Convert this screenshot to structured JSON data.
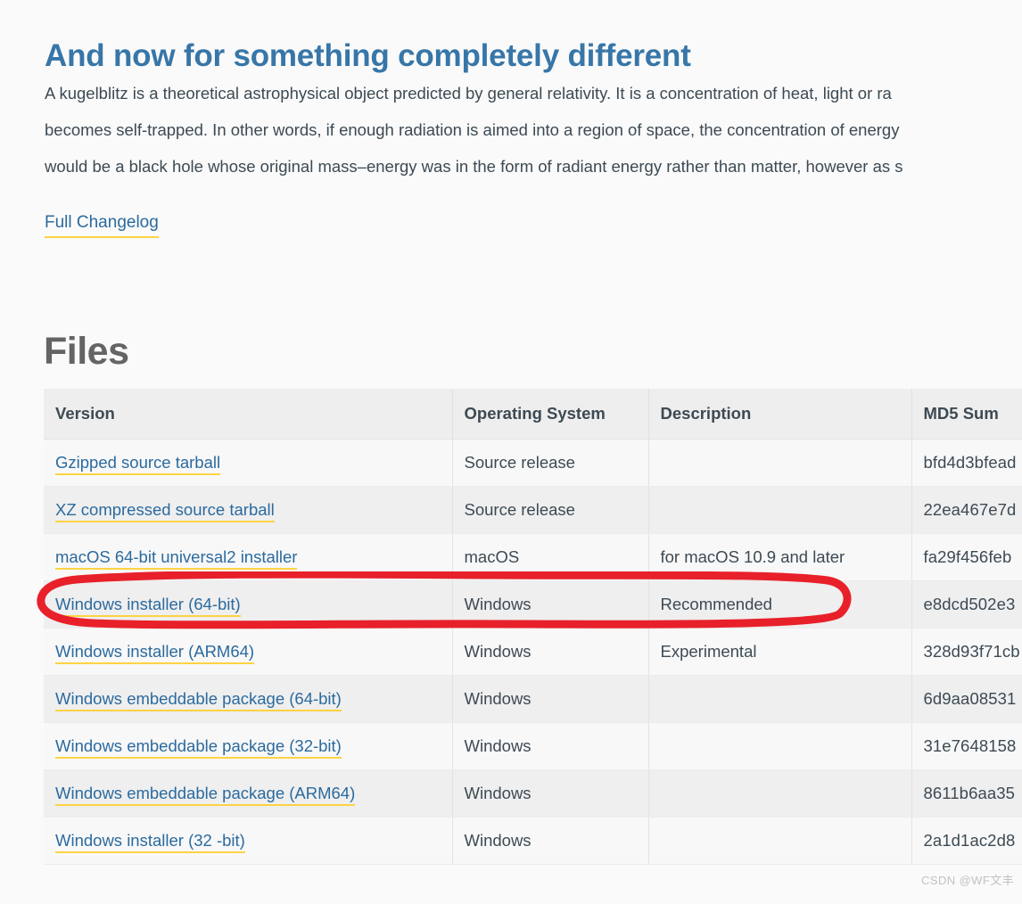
{
  "release": {
    "heading": "And now for something completely different",
    "body_lines": [
      "A kugelblitz is a theoretical astrophysical object predicted by general relativity. It is a concentration of heat, light or ra",
      "becomes self-trapped. In other words, if enough radiation is aimed into a region of space, the concentration of energy",
      "would be a black hole whose original mass–energy was in the form of radiant energy rather than matter, however as s"
    ],
    "changelog_link": "Full Changelog"
  },
  "files": {
    "heading": "Files",
    "columns": [
      "Version",
      "Operating System",
      "Description",
      "MD5 Sum"
    ],
    "rows": [
      {
        "version": "Gzipped source tarball",
        "os": "Source release",
        "description": "",
        "md5": "bfd4d3bfead"
      },
      {
        "version": "XZ compressed source tarball",
        "os": "Source release",
        "description": "",
        "md5": "22ea467e7d"
      },
      {
        "version": "macOS 64-bit universal2 installer",
        "os": "macOS",
        "description": "for macOS 10.9 and later",
        "md5": "fa29f456feb"
      },
      {
        "version": "Windows installer (64-bit)",
        "os": "Windows",
        "description": "Recommended",
        "md5": "e8dcd502e3"
      },
      {
        "version": "Windows installer (ARM64)",
        "os": "Windows",
        "description": "Experimental",
        "md5": "328d93f71cb"
      },
      {
        "version": "Windows embeddable package (64-bit)",
        "os": "Windows",
        "description": "",
        "md5": "6d9aa08531"
      },
      {
        "version": "Windows embeddable package (32-bit)",
        "os": "Windows",
        "description": "",
        "md5": "31e7648158"
      },
      {
        "version": "Windows embeddable package (ARM64)",
        "os": "Windows",
        "description": "",
        "md5": "8611b6aa35"
      },
      {
        "version": "Windows installer (32 -bit)",
        "os": "Windows",
        "description": "",
        "md5": "2a1d1ac2d8"
      }
    ],
    "highlighted_row_index": 3
  },
  "annotation": {
    "shape": "red-oval",
    "color": "#e8202a",
    "target_row": "Windows installer (64-bit)"
  },
  "watermark": "CSDN @WF文丰",
  "colors": {
    "page_background": "#fafafa",
    "heading_blue": "#3776a8",
    "link_blue": "#2b6a9e",
    "link_underline_yellow": "#ffd343",
    "body_text": "#3d4a53",
    "files_heading_gray": "#646464",
    "table_header_bg": "#eeeeee",
    "row_odd_bg": "#f8f8f8",
    "row_even_bg": "#efefef",
    "annotation_red": "#e8202a",
    "watermark_gray": "#c2c2c2"
  }
}
